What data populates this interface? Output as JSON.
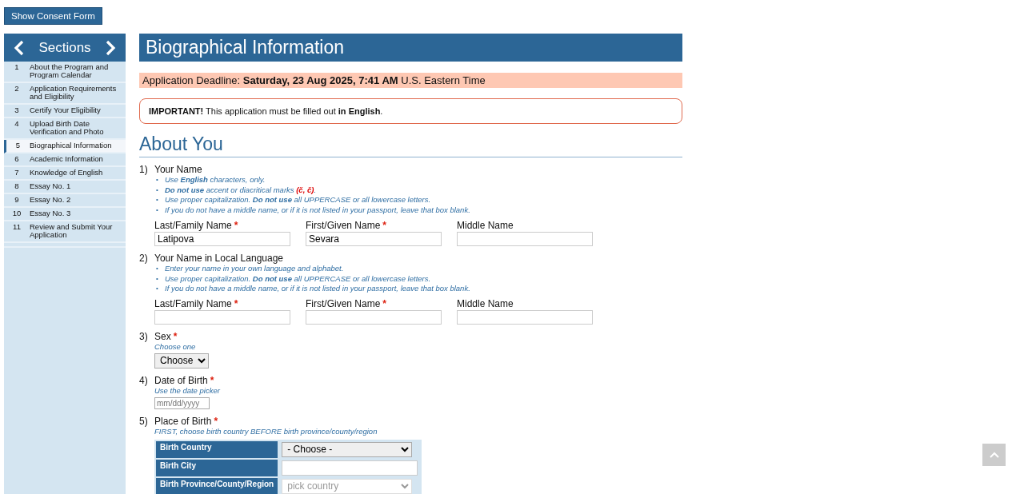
{
  "consent_button": "Show Consent Form",
  "sidebar": {
    "title": "Sections",
    "items": [
      {
        "number": "1",
        "label": "About the Program and Program Calendar",
        "selected": false
      },
      {
        "number": "2",
        "label": "Application Requirements and Eligibility",
        "selected": false
      },
      {
        "number": "3",
        "label": "Certify Your Eligibility",
        "selected": false
      },
      {
        "number": "4",
        "label": "Upload Birth Date Verification and Photo",
        "selected": false
      },
      {
        "number": "5",
        "label": "Biographical Information",
        "selected": true
      },
      {
        "number": "6",
        "label": "Academic Information",
        "selected": false
      },
      {
        "number": "7",
        "label": "Knowledge of English",
        "selected": false
      },
      {
        "number": "8",
        "label": "Essay No. 1",
        "selected": false
      },
      {
        "number": "9",
        "label": "Essay No. 2",
        "selected": false
      },
      {
        "number": "10",
        "label": "Essay No. 3",
        "selected": false
      },
      {
        "number": "11",
        "label": "Review and Submit Your Application",
        "selected": false
      }
    ]
  },
  "page_title": "Biographical Information",
  "deadline": "Application Deadline: **Saturday, 23 Aug 2025, 7:41 AM** U.S. Eastern Time",
  "notice": "**IMPORTANT!** This application must be filled out **in English**.",
  "section_heading": "About You",
  "required_mark": "*",
  "bullet": "•",
  "questions": [
    {
      "kind": "names",
      "number": "1)",
      "label": "Your Name",
      "hints": [
        "Use **English** characters, only.",
        "**Do not use** accent or diacritical marks *(č, č)*.",
        "Use proper capitalization. **Do not use** all UPPERCASE or all lowercase letters.",
        "If you do not have a middle name, or if it is not listed in your passport, leave that box blank."
      ],
      "fields": [
        {
          "label": "Last/Family Name",
          "required": true,
          "value": "Latipova"
        },
        {
          "label": "First/Given Name",
          "required": true,
          "value": "Sevara"
        },
        {
          "label": "Middle Name"
        }
      ]
    },
    {
      "kind": "names",
      "number": "2)",
      "label": "Your Name in Local Language",
      "hints": [
        "Enter your name in your own language and alphabet.",
        "Use proper capitalization. **Do not use** all UPPERCASE or all lowercase letters.",
        "If you do not have a middle name, or if it is not listed in your passport, leave that box blank."
      ],
      "fields": [
        {
          "label": "Last/Family Name",
          "required": true
        },
        {
          "label": "First/Given Name",
          "required": true
        },
        {
          "label": "Middle Name"
        }
      ]
    },
    {
      "kind": "select",
      "number": "3)",
      "label": "Sex",
      "required": true,
      "note": "Choose one",
      "value": "Choose"
    },
    {
      "kind": "date",
      "number": "4)",
      "label": "Date of Birth",
      "required": true,
      "note": "Use the date picker",
      "placeholder": "mm/dd/yyyy"
    },
    {
      "kind": "place",
      "number": "5)",
      "label": "Place of Birth",
      "required": true,
      "note": "FIRST, choose birth country BEFORE birth province/county/region",
      "rows": [
        {
          "label": "Birth Country",
          "kind": "select",
          "value": "- Choose -",
          "disabled": false
        },
        {
          "label": "Birth City",
          "kind": "text",
          "disabled": false
        },
        {
          "label": "Birth Province/County/Region",
          "kind": "select",
          "value": "pick country",
          "disabled": true
        }
      ]
    }
  ]
}
